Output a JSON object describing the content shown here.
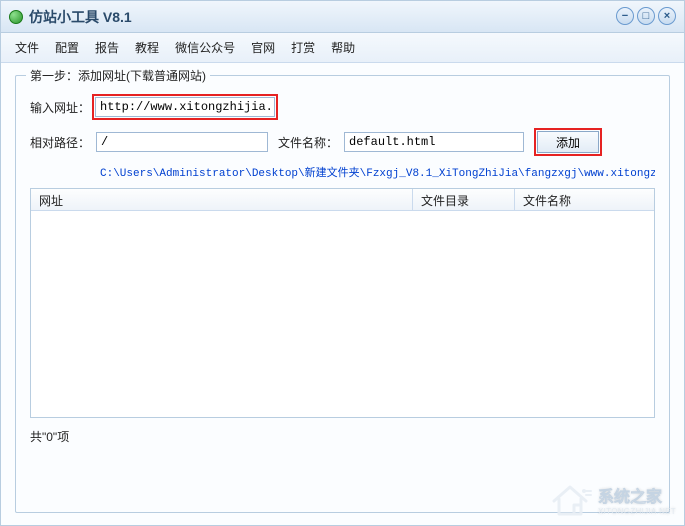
{
  "window": {
    "title": "仿站小工具 V8.1"
  },
  "menu": {
    "file": "文件",
    "config": "配置",
    "report": "报告",
    "tutorial": "教程",
    "wechat": "微信公众号",
    "website": "官网",
    "donate": "打赏",
    "help": "帮助"
  },
  "group": {
    "legend": "第一步：添加网址(下载普通网站)"
  },
  "form": {
    "url_label": "输入网址：",
    "url_value": "http://www.xitongzhijia.net/",
    "path_label": "相对路径：",
    "path_value": "/",
    "file_label": "文件名称：",
    "file_value": "default.html",
    "add_button": "添加",
    "save_path": "C:\\Users\\Administrator\\Desktop\\新建文件夹\\Fzxgj_V8.1_XiTongZhiJia\\fangzxgj\\www.xitongzhijia."
  },
  "table": {
    "col_url": "网址",
    "col_dir": "文件目录",
    "col_name": "文件名称"
  },
  "footer": {
    "count_text": "共\"0\"项"
  },
  "watermark": {
    "cn": "系统之家",
    "en": "XITONGZHIJIA.NET"
  }
}
